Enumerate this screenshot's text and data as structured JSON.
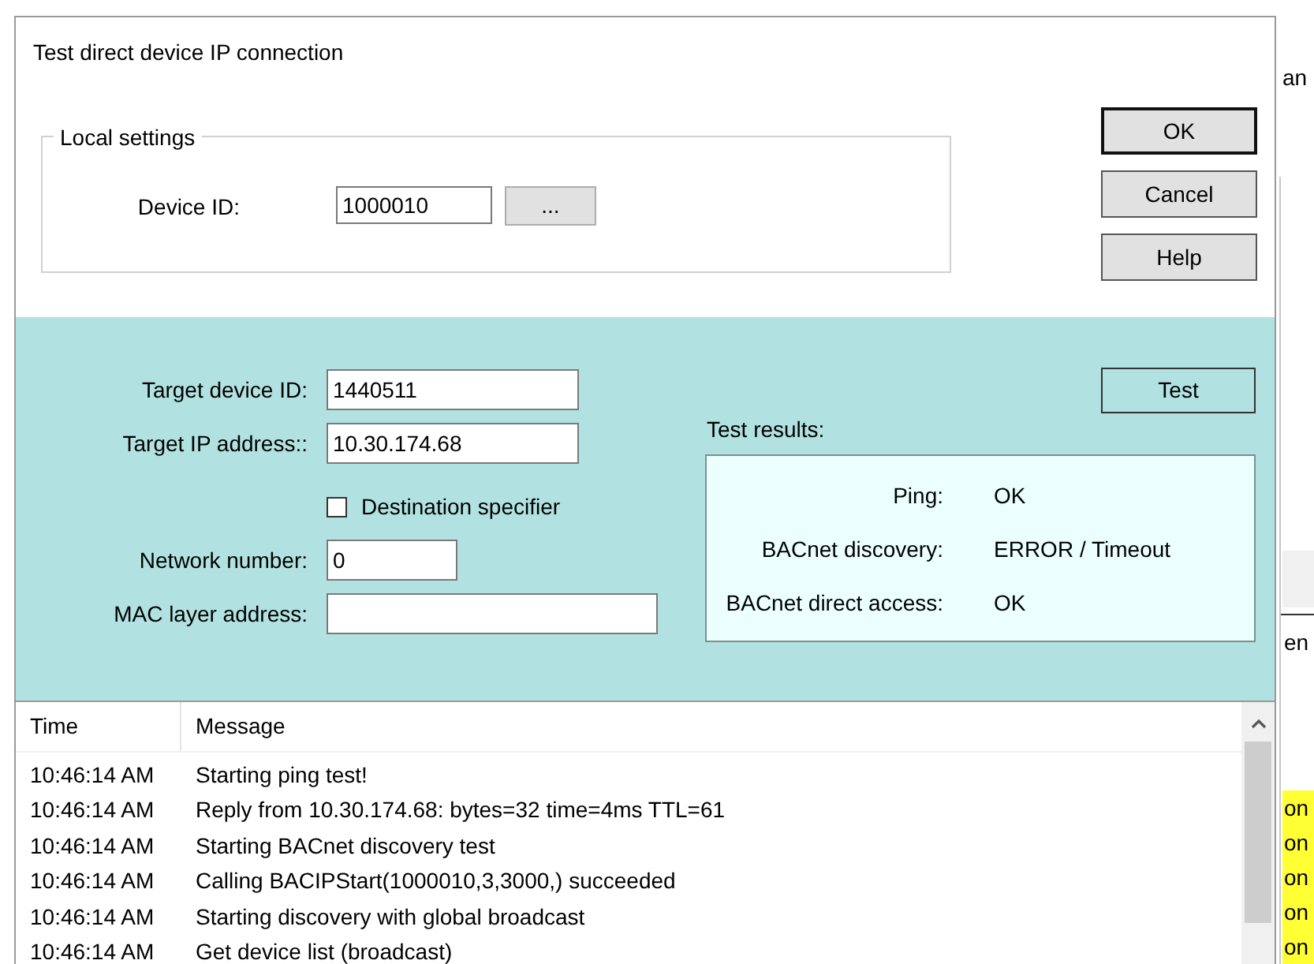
{
  "background": {
    "side_texts": [
      {
        "text": "an",
        "kind": "plain"
      },
      {
        "text": "en",
        "kind": "header"
      }
    ],
    "highlighted_cells": [
      "on",
      "on",
      "on",
      "on",
      "on"
    ]
  },
  "dialog": {
    "title": "Test direct device IP connection",
    "local_settings": {
      "legend": "Local settings",
      "device_id": {
        "label": "Device ID:",
        "value": "1000010"
      },
      "browse_button": "..."
    },
    "buttons": [
      {
        "label": "OK",
        "default": true
      },
      {
        "label": "Cancel",
        "default": false
      },
      {
        "label": "Help",
        "default": false
      }
    ],
    "target_rows": [
      {
        "kind": "field",
        "label": "Target device ID:",
        "value": "1440511"
      },
      {
        "kind": "field",
        "label": "Target IP address::",
        "value": "10.30.174.68"
      },
      {
        "kind": "checkbox",
        "label": "Destination specifier",
        "checked": false
      },
      {
        "kind": "field",
        "label": "Network number:",
        "value": "0"
      },
      {
        "kind": "field",
        "label": "MAC layer address:",
        "value": ""
      }
    ],
    "test_button": "Test",
    "test_results": {
      "title": "Test results:",
      "rows": [
        {
          "label": "Ping:",
          "value": "OK"
        },
        {
          "label": "BACnet discovery:",
          "value": "ERROR / Timeout"
        },
        {
          "label": "BACnet direct access:",
          "value": "OK"
        }
      ]
    },
    "log": {
      "columns": [
        "Time",
        "Message"
      ],
      "rows": [
        {
          "time": "10:46:14 AM",
          "message": "Starting ping test!"
        },
        {
          "time": "10:46:14 AM",
          "message": "Reply from 10.30.174.68: bytes=32 time=4ms TTL=61"
        },
        {
          "time": "10:46:14 AM",
          "message": "Starting BACnet discovery test"
        },
        {
          "time": "10:46:14 AM",
          "message": "Calling BACIPStart(1000010,3,3000,) succeeded"
        },
        {
          "time": "10:46:14 AM",
          "message": "Starting discovery with global broadcast"
        },
        {
          "time": "10:46:14 AM",
          "message": "Get device list (broadcast)"
        }
      ]
    }
  }
}
